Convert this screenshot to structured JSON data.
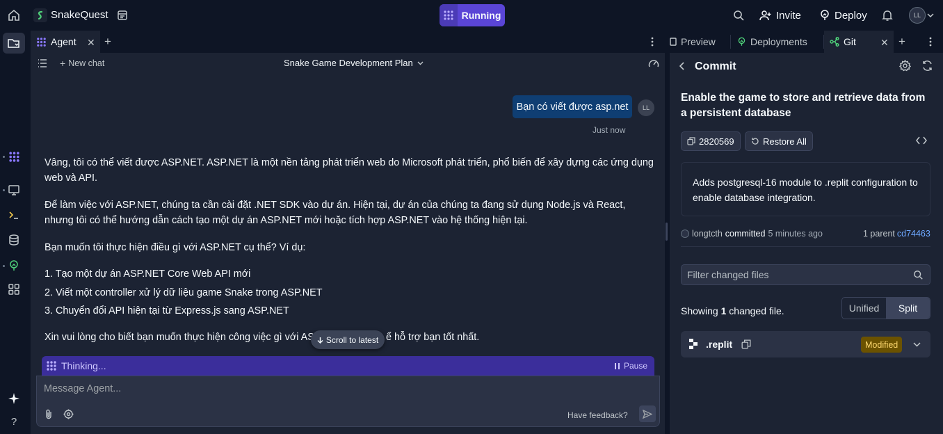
{
  "topbar": {
    "app_name": "SnakeQuest",
    "run_status": "Running",
    "invite_label": "Invite",
    "deploy_label": "Deploy",
    "avatar_initials": "LL"
  },
  "agent": {
    "tab_label": "Agent",
    "new_chat_label": "New chat",
    "chat_title": "Snake Game Development Plan",
    "user_message": "Bạn có viết được asp.net",
    "user_initials": "LL",
    "user_time": "Just now",
    "reply_paragraphs": [
      "Vâng, tôi có thể viết được ASP.NET. ASP.NET là một nền tảng phát triển web do Microsoft phát triển, phổ biến để xây dựng các ứng dụng web và API.",
      "Để làm việc với ASP.NET, chúng ta cần cài đặt .NET SDK vào dự án. Hiện tại, dự án của chúng ta đang sử dụng Node.js và React, nhưng tôi có thể hướng dẫn cách tạo một dự án ASP.NET mới hoặc tích hợp ASP.NET vào hệ thống hiện tại.",
      "Bạn muốn tôi thực hiện điều gì với ASP.NET cụ thể? Ví dụ:"
    ],
    "reply_list": [
      "1. Tạo một dự án ASP.NET Core Web API mới",
      "2. Viết một controller xử lý dữ liệu game Snake trong ASP.NET",
      "3. Chuyển đổi API hiện tại từ Express.js sang ASP.NET"
    ],
    "reply_closing_left": "Xin vui lòng cho biết bạn muốn thực hiện công việc gì với ASP",
    "reply_closing_right": "ể hỗ trợ bạn tốt nhất.",
    "scroll_latest_label": "Scroll to latest",
    "thinking_label": "Thinking...",
    "pause_label": "Pause",
    "composer_placeholder": "Message Agent...",
    "feedback_label": "Have feedback?"
  },
  "right": {
    "tabs": [
      {
        "label": "Preview"
      },
      {
        "label": "Deployments"
      },
      {
        "label": "Git"
      }
    ],
    "header_title": "Commit",
    "commit_title": "Enable the game to store and retrieve data from a persistent database",
    "commit_hash": "2820569",
    "restore_label": "Restore All",
    "commit_description": "Adds postgresql-16 module to .replit configuration to enable database integration.",
    "author": "longtcth",
    "committed_word": "committed",
    "time_ago": "5 minutes ago",
    "parent_label": "1 parent",
    "parent_hash": "cd74463",
    "filter_placeholder": "Filter changed files",
    "showing_prefix": "Showing ",
    "showing_count": "1",
    "showing_suffix": " changed file.",
    "view_unified": "Unified",
    "view_split": "Split",
    "file_name": ".replit",
    "file_status": "Modified"
  },
  "colors": {
    "background": "#0e1525",
    "panel": "#1c2333",
    "accent_running": "#5a45d6",
    "user_bubble": "#0f3e73",
    "link": "#6ea8ff",
    "modified_badge": "#6b5200"
  }
}
